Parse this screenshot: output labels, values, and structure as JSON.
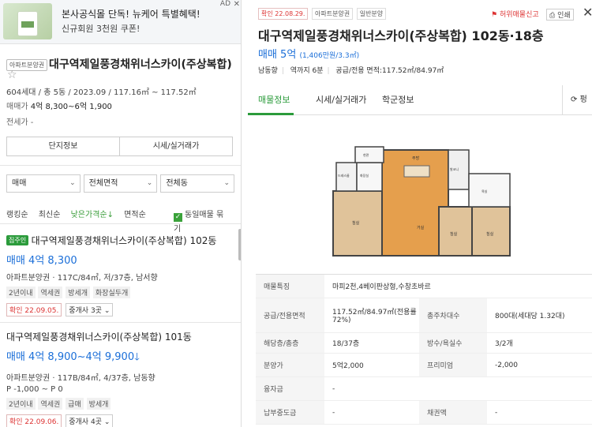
{
  "ad": {
    "title": "본사공식몰 단독! 뉴케어 특별혜택!",
    "subtitle": "신규회원 3천원 쿠폰!",
    "badge": "AD",
    "close": "✕"
  },
  "complex": {
    "type_tag": "아파트분양권",
    "name": "대구역제일풍경채위너스카이(주상복합)",
    "meta": "604세대 / 총 5동 / 2023.09 / 117.16㎡ ~ 117.52㎡",
    "price_label": "매매가",
    "price_value": "4억 8,300~6억 1,900",
    "jeonse_label": "전세가",
    "jeonse_value": "-"
  },
  "tabs": [
    "단지정보",
    "시세/실거래가"
  ],
  "filters": [
    {
      "label": "매매"
    },
    {
      "label": "전체면적"
    },
    {
      "label": "전체동"
    }
  ],
  "sort": {
    "options": [
      "랭킹순",
      "최신순",
      "낮은가격순↓",
      "면적순"
    ],
    "active_index": 2,
    "same_group_label": "동일매물 묶기",
    "same_group_checked": true
  },
  "listings": [
    {
      "tag": "집주인",
      "name": "대구역제일풍경채위너스카이(주상복합) 102동",
      "price": "매매 4억 8,300",
      "desc": "아파트분양권 · 117C/84㎡, 저/37층, 남서향",
      "chips": [
        "2년이내",
        "역세권",
        "방세개",
        "화장실두개"
      ],
      "confirmed": "확인 22.09.05.",
      "agents": "중개사 3곳"
    },
    {
      "tag": "",
      "name": "대구역제일풍경채위너스카이(주상복합) 101동",
      "price": "매매 4억 8,900~4억 9,900",
      "desc": "아파트분양권 · 117B/84㎡, 4/37층, 남동향",
      "extra": "P -1,000 ~ P 0",
      "chips": [
        "2년이내",
        "역세권",
        "급매",
        "방세개"
      ],
      "confirmed": "확인 22.09.06.",
      "agents": "중개사 4곳"
    }
  ],
  "detail": {
    "tags": [
      "확인 22.08.29.",
      "아파트분양권",
      "일반분양"
    ],
    "report": "허위매물신고",
    "print": "인쇄",
    "close": "✕",
    "title": "대구역제일풍경채위너스카이(주상복합) 102동·18층",
    "price": "매매 5억",
    "price_per": "(1,406만원/3.3㎡)",
    "info": [
      "남동향",
      "역까지 6분",
      "공급/전용 면적:117.52㎡/84.97㎡"
    ],
    "tabs": [
      "매물정보",
      "시세/실거래가",
      "학군정보"
    ],
    "active_tab": 0,
    "refresh": "펑",
    "plan_labels": [
      "침실",
      "거실",
      "주방",
      "침실",
      "침실",
      "드레스룸",
      "화장실",
      "발코니",
      "욕실",
      "현관"
    ],
    "spec": [
      {
        "k": "매물특징",
        "v": "마피2천,4베이판상형,수창초바르",
        "k2": "",
        "v2": ""
      },
      {
        "k": "공급/전용면적",
        "v": "117.52㎡/84.97㎡(전용률72%)",
        "k2": "총주차대수",
        "v2": "800대(세대당 1.32대)"
      },
      {
        "k": "해당층/총층",
        "v": "18/37층",
        "k2": "방수/욕실수",
        "v2": "3/2개"
      },
      {
        "k": "분양가",
        "v": "5억2,000",
        "k2": "프리미엄",
        "v2": "-2,000"
      },
      {
        "k": "융자금",
        "v": "-",
        "k2": "",
        "v2": ""
      },
      {
        "k": "납부중도금",
        "v": "-",
        "k2": "채권액",
        "v2": "-"
      }
    ]
  }
}
